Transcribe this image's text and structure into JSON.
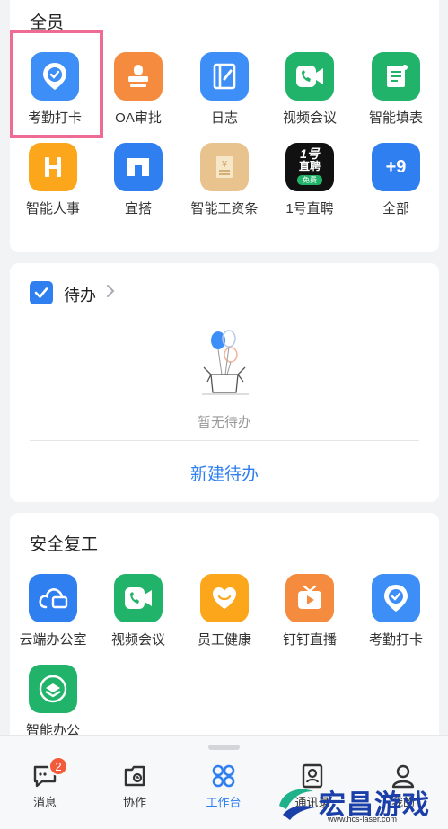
{
  "all_section": {
    "title": "全员",
    "apps": [
      {
        "label": "考勤打卡",
        "icon": "attendance-checkin-icon",
        "color": "#3d8ef7"
      },
      {
        "label": "OA审批",
        "icon": "oa-approval-icon",
        "color": "#f58b3e"
      },
      {
        "label": "日志",
        "icon": "log-icon",
        "color": "#3d8ef7"
      },
      {
        "label": "视频会议",
        "icon": "video-meeting-icon",
        "color": "#22b36a"
      },
      {
        "label": "智能填表",
        "icon": "smart-form-icon",
        "color": "#22b36a"
      },
      {
        "label": "智能人事",
        "icon": "smart-hr-icon",
        "color": "#fca61c"
      },
      {
        "label": "宜搭",
        "icon": "yida-icon",
        "color": "#2f7ff0"
      },
      {
        "label": "智能工资条",
        "icon": "salary-slip-icon",
        "color": "#e8c38d"
      },
      {
        "label": "1号直聘",
        "icon": "hiring-icon",
        "color": "#111111",
        "icon_text_1": "1号",
        "icon_text_2": "直聘",
        "icon_badge": "免费"
      },
      {
        "label": "全部",
        "icon": "all-apps-icon",
        "color": "#2f7ff0",
        "icon_text": "+9"
      }
    ]
  },
  "todo": {
    "title": "待办",
    "empty_text": "暂无待办",
    "new_label": "新建待办"
  },
  "safety_section": {
    "title": "安全复工",
    "apps": [
      {
        "label": "云端办公室",
        "icon": "cloud-office-icon",
        "color": "#2f7ff0"
      },
      {
        "label": "视频会议",
        "icon": "video-meeting-icon",
        "color": "#22b36a"
      },
      {
        "label": "员工健康",
        "icon": "employee-health-icon",
        "color": "#fca61c"
      },
      {
        "label": "钉钉直播",
        "icon": "live-stream-icon",
        "color": "#f58b3e"
      },
      {
        "label": "考勤打卡",
        "icon": "attendance-checkin-icon",
        "color": "#3d8ef7"
      },
      {
        "label": "智能办公",
        "icon": "smart-office-icon",
        "color": "#22b36a"
      }
    ]
  },
  "tabbar": {
    "tabs": [
      {
        "label": "消息",
        "icon": "message-icon",
        "badge": "2"
      },
      {
        "label": "协作",
        "icon": "collaboration-icon"
      },
      {
        "label": "工作台",
        "icon": "workbench-icon",
        "active": true
      },
      {
        "label": "通讯录",
        "icon": "contacts-icon"
      },
      {
        "label": "我的",
        "icon": "profile-icon"
      }
    ]
  },
  "watermark": {
    "text": "宏昌游戏网",
    "url": "www.hcs-laser.com"
  }
}
